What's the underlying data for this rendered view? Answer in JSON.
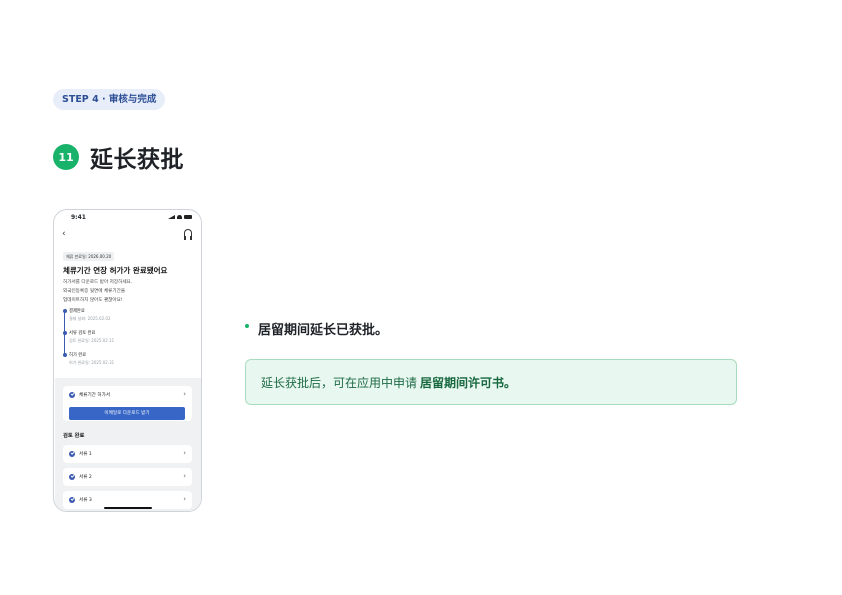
{
  "step_badge": "STEP 4 · 审核与完成",
  "section": {
    "number": "11",
    "title": "延长获批"
  },
  "phone": {
    "status_time": "9:41",
    "date_chip": "체류 만료일: 2026.00.20",
    "heading": "체류기간 연장 허가가 완료됐어요",
    "desc_lines": [
      "허가서를 다운로드 받아 저장하세요.",
      "외국인등록증 뒷면에 체류기간을",
      "업데이트하지 않아도 괜찮아요!"
    ],
    "timeline": [
      {
        "label": "결제완료",
        "sub": "결제 날짜: 2025.02.02"
      },
      {
        "label": "서류 검토 완료",
        "sub": "검토 완료일: 2025.02.11"
      },
      {
        "label": "허가 완료",
        "sub": "허가 완료일: 2025.02.31"
      }
    ],
    "permit_card": {
      "label": "체류기간 허가서",
      "button": "이메일로 다운로드 받기"
    },
    "review_section": "검토 완료",
    "documents": [
      "서류 1",
      "서류 2",
      "서류 3"
    ]
  },
  "bullet": "居留期间延长已获批。",
  "info": {
    "text": "延长获批后，可在应用中申请",
    "strong": "居留期间许可书。"
  },
  "colors": {
    "green": "#19b26b",
    "blue": "#3766c7",
    "badge_bg": "#e8eef9",
    "info_bg": "#e8f7ef"
  }
}
